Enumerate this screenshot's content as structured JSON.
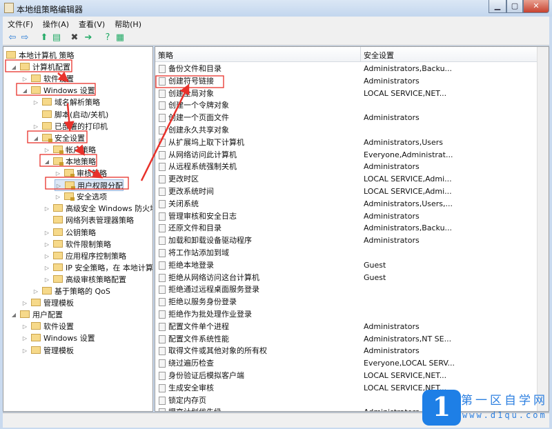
{
  "window": {
    "title": "本地组策略编辑器",
    "minimize": "▁",
    "maximize": "▢",
    "close": "✕"
  },
  "menu": [
    "文件(F)",
    "操作(A)",
    "查看(V)",
    "帮助(H)"
  ],
  "toolbar": [
    {
      "icon": "back-arrow",
      "glyph": "⇦"
    },
    {
      "icon": "forward-arrow",
      "glyph": "⇨"
    },
    {
      "icon": "up-folder",
      "glyph": "⬆"
    },
    {
      "icon": "show-hide-tree",
      "glyph": "▤"
    },
    {
      "icon": "delete",
      "glyph": "✖"
    },
    {
      "icon": "export-list",
      "glyph": "➔"
    },
    {
      "icon": "help",
      "glyph": "?"
    },
    {
      "icon": "properties",
      "glyph": "▦"
    }
  ],
  "tree": [
    {
      "label": "本地计算机 策略",
      "level": 0,
      "exp": ""
    },
    {
      "label": "计算机配置",
      "level": 1,
      "exp": "◢"
    },
    {
      "label": "软件设置",
      "level": 2,
      "exp": "▷"
    },
    {
      "label": "Windows 设置",
      "level": 2,
      "exp": "◢"
    },
    {
      "label": "域名解析策略",
      "level": 3,
      "exp": "▷"
    },
    {
      "label": "脚本(启动/关机)",
      "level": 3,
      "exp": ""
    },
    {
      "label": "已部署的打印机",
      "level": 3,
      "exp": "▷"
    },
    {
      "label": "安全设置",
      "level": 3,
      "exp": "◢"
    },
    {
      "label": "帐户策略",
      "level": 4,
      "exp": "▷"
    },
    {
      "label": "本地策略",
      "level": 4,
      "exp": "◢"
    },
    {
      "label": "审核策略",
      "level": 5,
      "exp": "▷"
    },
    {
      "label": "用户权限分配",
      "level": 5,
      "exp": "▷",
      "selected": true
    },
    {
      "label": "安全选项",
      "level": 5,
      "exp": "▷"
    },
    {
      "label": "高级安全 Windows 防火墙",
      "level": 4,
      "exp": "▷"
    },
    {
      "label": "网络列表管理器策略",
      "level": 4,
      "exp": ""
    },
    {
      "label": "公钥策略",
      "level": 4,
      "exp": "▷"
    },
    {
      "label": "软件限制策略",
      "level": 4,
      "exp": "▷"
    },
    {
      "label": "应用程序控制策略",
      "level": 4,
      "exp": "▷"
    },
    {
      "label": "IP 安全策略，在 本地计算机",
      "level": 4,
      "exp": "▷"
    },
    {
      "label": "高级审核策略配置",
      "level": 4,
      "exp": "▷"
    },
    {
      "label": "基于策略的 QoS",
      "level": 3,
      "exp": "▷"
    },
    {
      "label": "管理模板",
      "level": 2,
      "exp": "▷"
    },
    {
      "label": "用户配置",
      "level": 1,
      "exp": "◢"
    },
    {
      "label": "软件设置",
      "level": 2,
      "exp": "▷"
    },
    {
      "label": "Windows 设置",
      "level": 2,
      "exp": "▷"
    },
    {
      "label": "管理模板",
      "level": 2,
      "exp": "▷"
    }
  ],
  "list": {
    "columns": [
      "策略",
      "安全设置"
    ],
    "rows": [
      [
        "备份文件和目录",
        "Administrators,Backu..."
      ],
      [
        "创建符号链接",
        "Administrators"
      ],
      [
        "创建全局对象",
        "LOCAL SERVICE,NET..."
      ],
      [
        "创建一个令牌对象",
        ""
      ],
      [
        "创建一个页面文件",
        "Administrators"
      ],
      [
        "创建永久共享对象",
        ""
      ],
      [
        "从扩展坞上取下计算机",
        "Administrators,Users"
      ],
      [
        "从网络访问此计算机",
        "Everyone,Administrat..."
      ],
      [
        "从远程系统强制关机",
        "Administrators"
      ],
      [
        "更改时区",
        "LOCAL SERVICE,Admi..."
      ],
      [
        "更改系统时间",
        "LOCAL SERVICE,Admi..."
      ],
      [
        "关闭系统",
        "Administrators,Users,..."
      ],
      [
        "管理审核和安全日志",
        "Administrators"
      ],
      [
        "还原文件和目录",
        "Administrators,Backu..."
      ],
      [
        "加载和卸载设备驱动程序",
        "Administrators"
      ],
      [
        "将工作站添加到域",
        ""
      ],
      [
        "拒绝本地登录",
        "Guest"
      ],
      [
        "拒绝从网络访问这台计算机",
        "Guest"
      ],
      [
        "拒绝通过远程桌面服务登录",
        ""
      ],
      [
        "拒绝以服务身份登录",
        ""
      ],
      [
        "拒绝作为批处理作业登录",
        ""
      ],
      [
        "配置文件单个进程",
        "Administrators"
      ],
      [
        "配置文件系统性能",
        "Administrators,NT SE..."
      ],
      [
        "取得文件或其他对象的所有权",
        "Administrators"
      ],
      [
        "绕过遍历检查",
        "Everyone,LOCAL SERV..."
      ],
      [
        "身份验证后模拟客户端",
        "LOCAL SERVICE,NET..."
      ],
      [
        "生成安全审核",
        "LOCAL SERVICE,NET..."
      ],
      [
        "锁定内存页",
        ""
      ],
      [
        "提高计划优先级",
        "Administrators"
      ]
    ]
  },
  "watermark": {
    "logo": "1",
    "name": "第一区自学网",
    "url": "www.d1qu.com"
  },
  "annotation_color": "#e8312a"
}
